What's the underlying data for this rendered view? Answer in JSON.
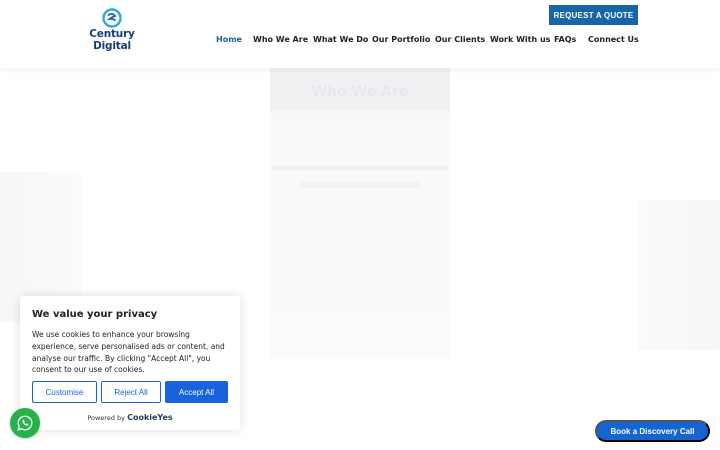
{
  "brand": {
    "logo_line1": "Century",
    "logo_line2": "Digital",
    "primary_color": "#1565a8",
    "logo_color": "#123f7a"
  },
  "header": {
    "quote_button": "REQUEST A QUOTE",
    "nav": [
      {
        "label": "Home",
        "active": true
      },
      {
        "label": "Who We Are",
        "active": false
      },
      {
        "label": "What We Do",
        "active": false
      },
      {
        "label": "Our Portfolio",
        "active": false
      },
      {
        "label": "Our Clients",
        "active": false
      },
      {
        "label": "Work With us",
        "active": false
      },
      {
        "label": "FAQs",
        "active": false
      },
      {
        "label": "Connect Us",
        "active": false
      }
    ]
  },
  "hero": {
    "title": "Who We Are"
  },
  "cookie_banner": {
    "title": "We value your privacy",
    "text": "We use cookies to enhance your browsing experience, serve personalised ads or content, and analyse our traffic. By clicking \"Accept All\", you consent to our use of cookies.",
    "customise_label": "Customise",
    "reject_label": "Reject All",
    "accept_label": "Accept All",
    "powered_by": "Powered by",
    "powered_brand": "CookieYes",
    "button_color": "#1863dc"
  },
  "floating": {
    "whatsapp_icon": "whatsapp-icon",
    "whatsapp_color": "#25b24a",
    "discovery_label": "Book a Discovery Call"
  }
}
